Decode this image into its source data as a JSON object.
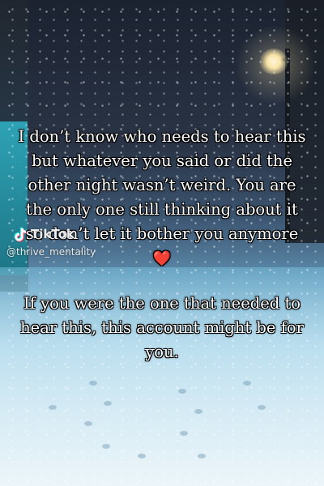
{
  "post": {
    "caption_main": "I don’t know who needs to hear this but whatever you said or did the other night wasn’t weird. You are the only one still thinking about it so don’t let it bother you anymore",
    "heart_emoji": "❤️",
    "caption_secondary": "If you were the one that needed to hear this, this account might be for you."
  },
  "watermark": {
    "brand": "TikTok",
    "handle": "@thrive_mentality",
    "logo_icon": "tiktok-logo-icon"
  },
  "colors": {
    "text": "#ffffff",
    "text_outline": "#000000",
    "heart": "#e3262c",
    "snow_blue": "#5f8fb0"
  }
}
